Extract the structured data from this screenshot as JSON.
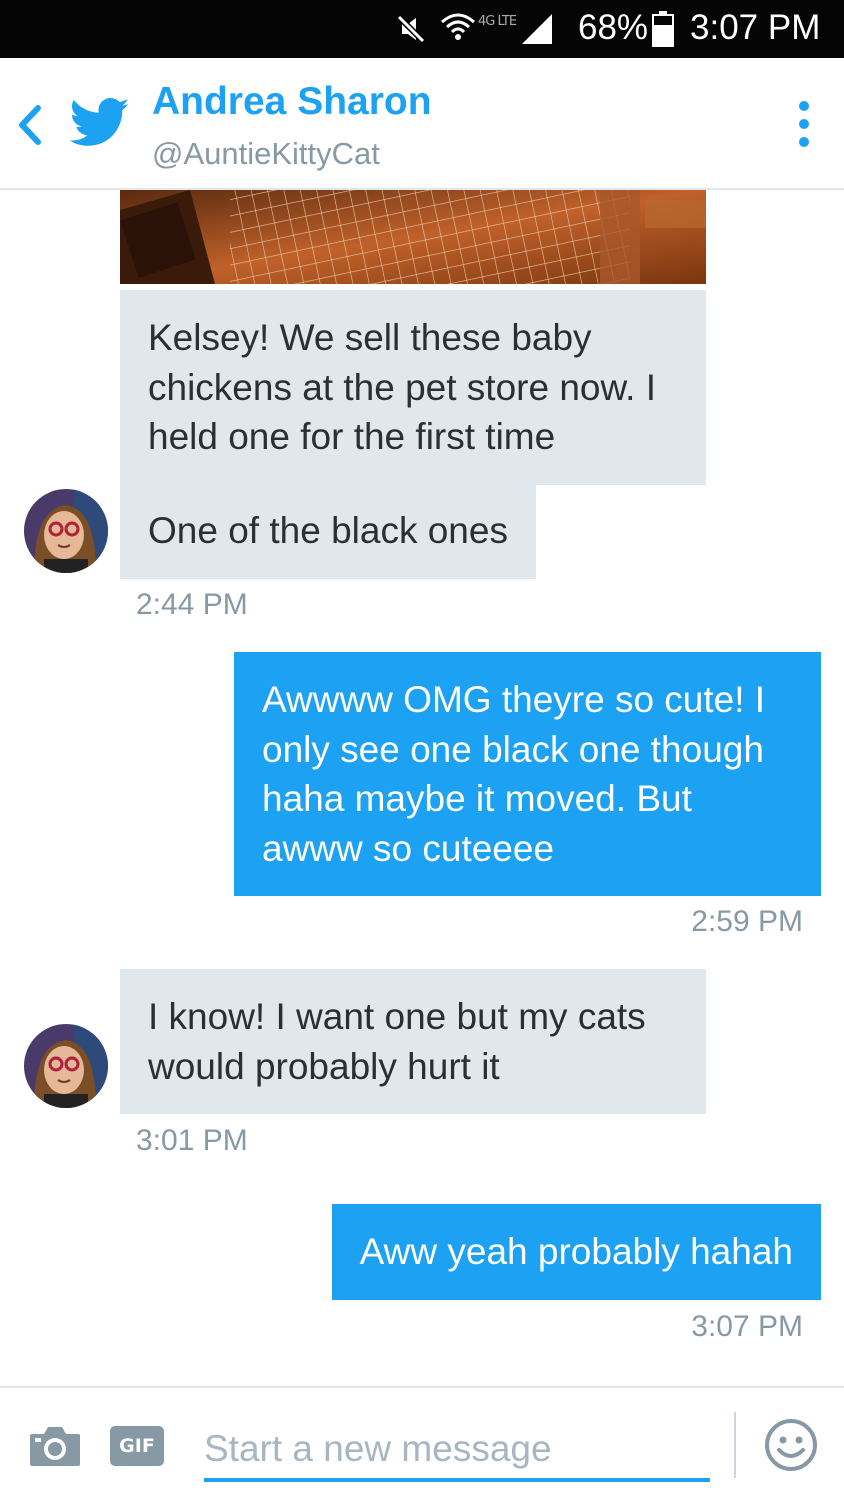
{
  "status_bar": {
    "battery": "68%",
    "time": "3:07 PM",
    "network": "4G LTE",
    "icons": [
      "mute-icon",
      "wifi-icon",
      "signal-icon",
      "battery-icon"
    ]
  },
  "header": {
    "name": "Andrea Sharon",
    "handle": "@AuntieKittyCat",
    "icons": [
      "back-icon",
      "twitter-bird-icon",
      "more-options-icon"
    ]
  },
  "conversation": {
    "messages": [
      {
        "direction": "incoming",
        "text": "Kelsey!  We sell these baby chickens at the pet store now.  I held one for the first time"
      },
      {
        "direction": "incoming",
        "text": "One of the black ones"
      },
      {
        "direction": "outgoing",
        "text": "Awwww OMG theyre so cute! I only see one black one though haha maybe it moved. But awww so cuteeee"
      },
      {
        "direction": "incoming",
        "text": "I know!  I want one but my cats would probably hurt it"
      },
      {
        "direction": "outgoing",
        "text": "Aww yeah probably hahah"
      }
    ],
    "timestamps": [
      "2:44 PM",
      "2:59 PM",
      "3:01 PM",
      "3:07 PM"
    ]
  },
  "composer": {
    "gif_label": "GIF",
    "placeholder": "Start a new message",
    "value": "",
    "icons": [
      "camera-icon",
      "emoji-icon"
    ]
  },
  "colors": {
    "accent": "#1da1f2",
    "incoming_bubble": "#e1e8ed",
    "timestamp": "#8899a6"
  }
}
